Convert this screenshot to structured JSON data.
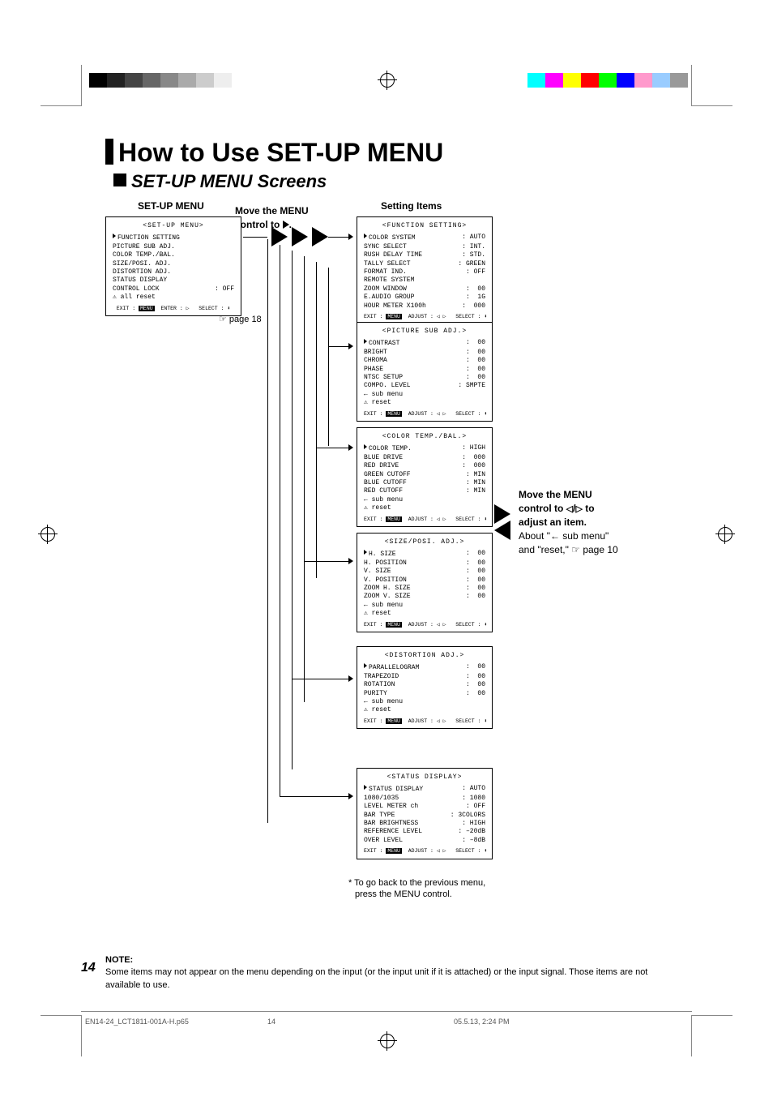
{
  "title": "How to Use SET-UP MENU",
  "section": "SET-UP MENU Screens",
  "labels": {
    "setup_menu": "SET-UP MENU",
    "setting_items": "Setting Items",
    "move_control": "Move the MENU control to",
    "page18": "☞ page 18"
  },
  "side_note": {
    "l1": "Move the MENU",
    "l2a": "control to ",
    "l2b": " to",
    "l3": "adjust an item.",
    "l4": "About \"← sub menu\"",
    "l5": "and \"reset,\" ☞ page 10"
  },
  "back_note": {
    "l1": "* To go back to the previous menu,",
    "l2": "press the MENU control."
  },
  "footnote": {
    "hdr": "NOTE:",
    "body": "Some items may not appear on the menu depending on the input (or the input unit if it is attached) or the input signal. Those items are not available to use."
  },
  "page_number": "14",
  "doc_left": "EN14-24_LCT1811-001A-H.p65",
  "doc_mid": "14",
  "doc_right": "05.5.13, 2:24 PM",
  "osd": {
    "setup": {
      "title": "<SET-UP  MENU>",
      "items": [
        {
          "k": "FUNCTION SETTING",
          "v": ""
        },
        {
          "k": "PICTURE SUB ADJ.",
          "v": ""
        },
        {
          "k": "COLOR TEMP./BAL.",
          "v": ""
        },
        {
          "k": "SIZE/POSI. ADJ.",
          "v": ""
        },
        {
          "k": "DISTORTION ADJ.",
          "v": ""
        },
        {
          "k": "STATUS DISPLAY",
          "v": ""
        },
        {
          "k": "CONTROL LOCK",
          "v": ": OFF"
        },
        {
          "k": "⚠ all reset",
          "v": ""
        }
      ],
      "foot": "EXIT : MENU  ENTER : ▷   SELECT : ⬍"
    },
    "func": {
      "title": "<FUNCTION SETTING>",
      "items": [
        {
          "k": "COLOR SYSTEM",
          "v": ": AUTO"
        },
        {
          "k": "SYNC SELECT",
          "v": ": INT."
        },
        {
          "k": "RUSH DELAY TIME",
          "v": ": STD."
        },
        {
          "k": "TALLY SELECT",
          "v": ": GREEN"
        },
        {
          "k": "FORMAT IND.",
          "v": ": OFF"
        },
        {
          "k": "REMOTE SYSTEM",
          "v": ""
        },
        {
          "k": "ZOOM WINDOW",
          "v": ":  00"
        },
        {
          "k": "E.AUDIO GROUP",
          "v": ":  1G"
        },
        {
          "k": "HOUR METER X100h",
          "v": ":  000"
        }
      ],
      "foot": "EXIT : MENU  ADJUST : ◁ ▷   SELECT : ⬍"
    },
    "picsub": {
      "title": "<PICTURE SUB ADJ.>",
      "items": [
        {
          "k": "CONTRAST",
          "v": ":  00"
        },
        {
          "k": "BRIGHT",
          "v": ":  00"
        },
        {
          "k": "CHROMA",
          "v": ":  00"
        },
        {
          "k": "PHASE",
          "v": ":  00"
        },
        {
          "k": "NTSC SETUP",
          "v": ":  00"
        },
        {
          "k": "COMPO. LEVEL",
          "v": ": SMPTE"
        },
        {
          "k": "← sub menu",
          "v": ""
        },
        {
          "k": "⚠ reset",
          "v": ""
        }
      ],
      "foot": "EXIT : MENU  ADJUST : ◁ ▷   SELECT : ⬍"
    },
    "colortemp": {
      "title": "<COLOR TEMP./BAL.>",
      "items": [
        {
          "k": "COLOR TEMP.",
          "v": ": HIGH"
        },
        {
          "k": "BLUE DRIVE",
          "v": ":  000"
        },
        {
          "k": "RED DRIVE",
          "v": ":  000"
        },
        {
          "k": "GREEN CUTOFF",
          "v": ": MIN"
        },
        {
          "k": "BLUE CUTOFF",
          "v": ": MIN"
        },
        {
          "k": "RED CUTOFF",
          "v": ": MIN"
        },
        {
          "k": "← sub menu",
          "v": ""
        },
        {
          "k": "⚠ reset",
          "v": ""
        }
      ],
      "foot": "EXIT : MENU  ADJUST : ◁ ▷   SELECT : ⬍"
    },
    "sizeposi": {
      "title": "<SIZE/POSI. ADJ.>",
      "items": [
        {
          "k": "H. SIZE",
          "v": ":  00"
        },
        {
          "k": "H. POSITION",
          "v": ":  00"
        },
        {
          "k": "V. SIZE",
          "v": ":  00"
        },
        {
          "k": "V. POSITION",
          "v": ":  00"
        },
        {
          "k": "ZOOM H. SIZE",
          "v": ":  00"
        },
        {
          "k": "ZOOM V. SIZE",
          "v": ":  00"
        },
        {
          "k": "← sub menu",
          "v": ""
        },
        {
          "k": "⚠ reset",
          "v": ""
        }
      ],
      "foot": "EXIT : MENU  ADJUST : ◁ ▷   SELECT : ⬍"
    },
    "distortion": {
      "title": "<DISTORTION ADJ.>",
      "items": [
        {
          "k": "PARALLELOGRAM",
          "v": ":  00"
        },
        {
          "k": "TRAPEZOID",
          "v": ":  00"
        },
        {
          "k": "ROTATION",
          "v": ":  00"
        },
        {
          "k": "PURITY",
          "v": ":  00"
        },
        {
          "k": "← sub menu",
          "v": ""
        },
        {
          "k": "⚠ reset",
          "v": ""
        }
      ],
      "foot": "EXIT : MENU  ADJUST : ◁ ▷   SELECT : ⬍"
    },
    "status": {
      "title": "<STATUS DISPLAY>",
      "items": [
        {
          "k": "STATUS DISPLAY",
          "v": ": AUTO"
        },
        {
          "k": "1080/1035",
          "v": ": 1080"
        },
        {
          "k": "LEVEL METER ch",
          "v": ": OFF"
        },
        {
          "k": "BAR TYPE",
          "v": ": 3COLORS"
        },
        {
          "k": "BAR BRIGHTNESS",
          "v": ": HIGH"
        },
        {
          "k": "REFERENCE LEVEL",
          "v": ": –20dB"
        },
        {
          "k": "OVER LEVEL",
          "v": ": –8dB"
        }
      ],
      "foot": "EXIT : MENU  ADJUST : ◁ ▷   SELECT : ⬍"
    }
  }
}
